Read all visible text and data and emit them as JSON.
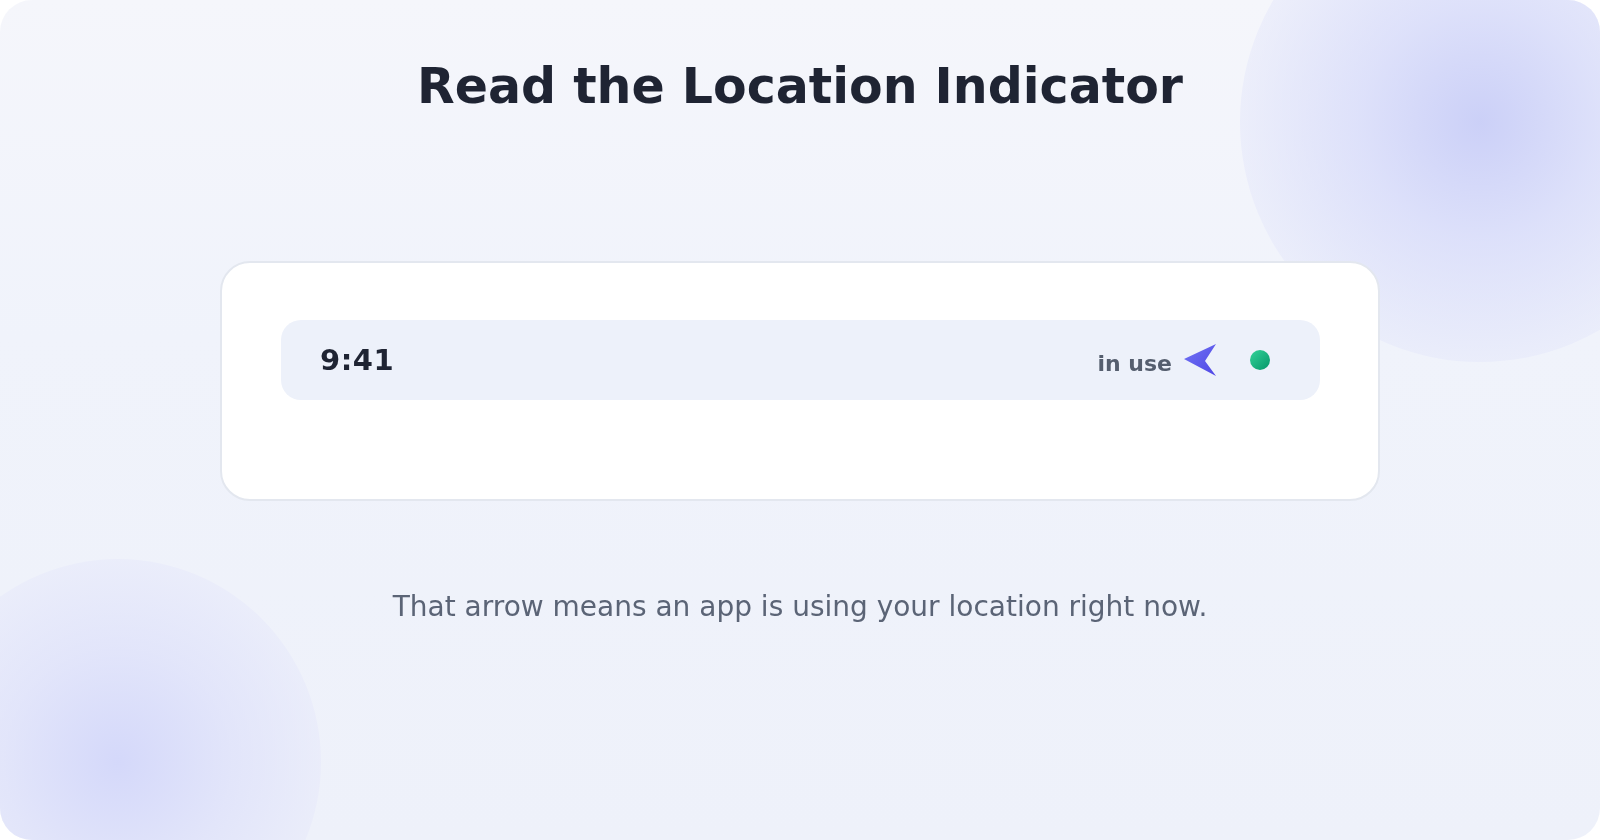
{
  "title": "Read the Location Indicator",
  "status_bar": {
    "time": "9:41",
    "location_label": "in use"
  },
  "caption": "That arrow means an app is using your location right now."
}
